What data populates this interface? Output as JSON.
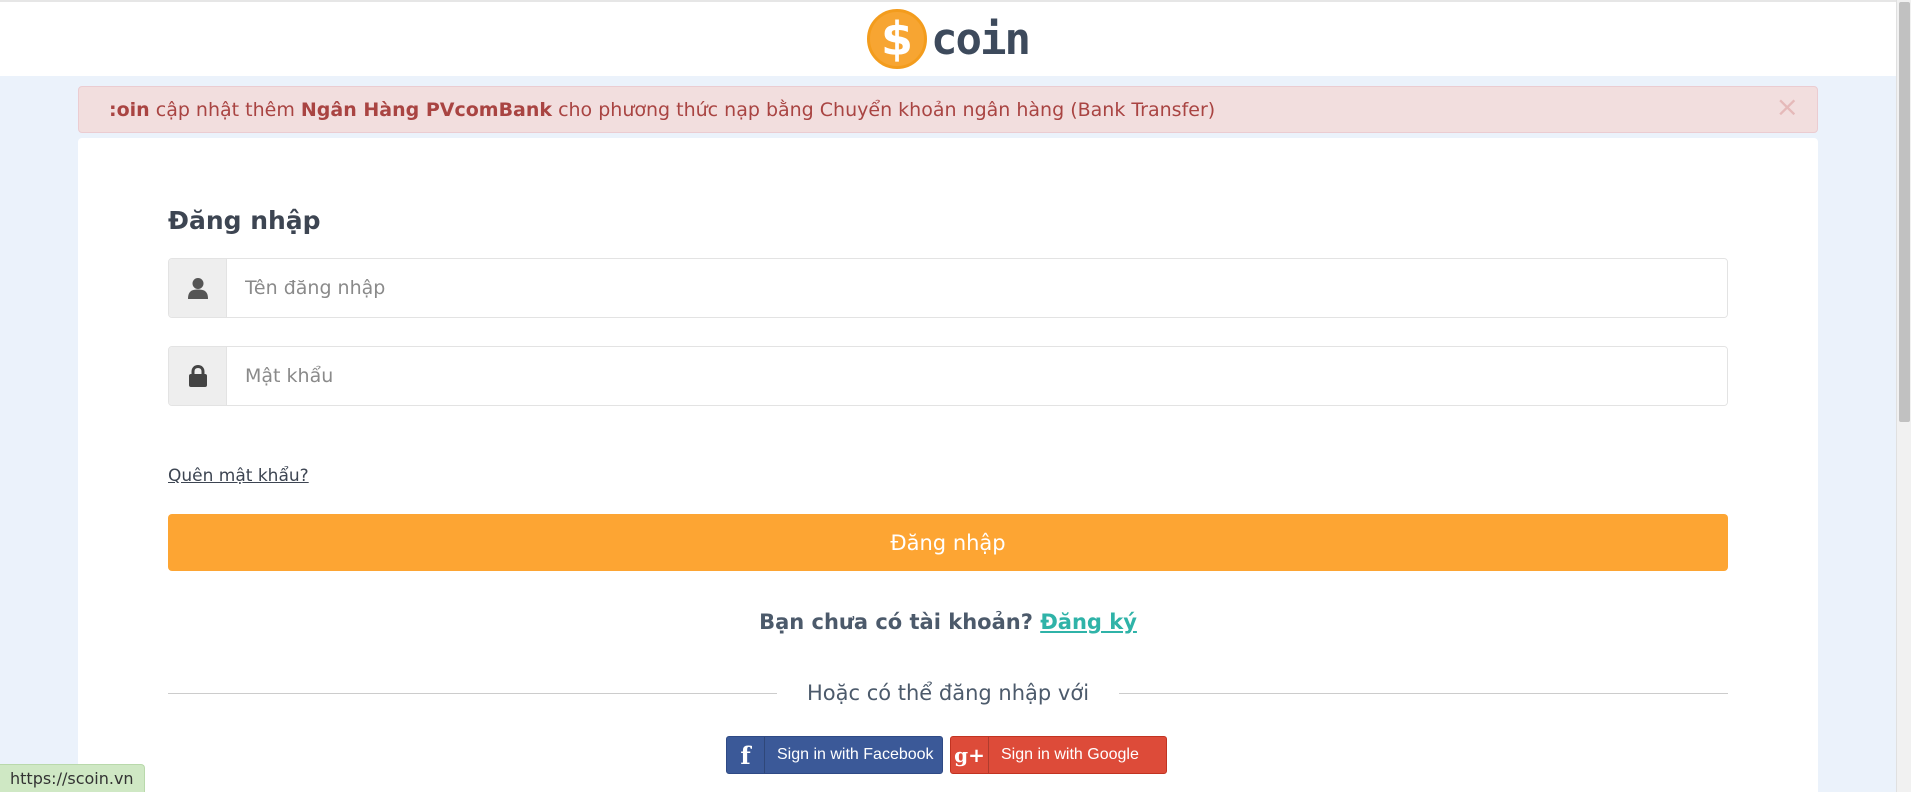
{
  "header": {
    "logo_symbol": "$",
    "logo_text": "coin"
  },
  "alert": {
    "prefix_bold": ":oin",
    "text_1": " cập nhật thêm ",
    "bank_bold": "Ngân Hàng PVcomBank",
    "text_2": " cho phương thức nạp bằng Chuyển khoản ngân hàng (Bank Transfer)",
    "close_symbol": "×"
  },
  "login_form": {
    "title": "Đăng nhập",
    "username_placeholder": "Tên đăng nhập",
    "password_placeholder": "Mật khẩu",
    "forgot_password": "Quên mật khẩu?",
    "submit_label": "Đăng nhập",
    "no_account_text": "Bạn chưa có tài khoản? ",
    "register_link": "Đăng ký",
    "divider_text": "Hoặc có thể đăng nhập với"
  },
  "social": {
    "facebook_icon": "f",
    "facebook_label": "Sign in with Facebook",
    "google_icon": "g+",
    "google_label": "Sign in with Google"
  },
  "status_bar": {
    "url": "https://scoin.vn"
  },
  "icons": {
    "user": "user-icon",
    "lock": "lock-icon",
    "facebook": "facebook-icon",
    "google": "google-plus-icon"
  },
  "colors": {
    "accent": "#fda533",
    "alert_bg": "#f2dede",
    "alert_text": "#a94442",
    "link": "#2fb3a8",
    "facebook": "#3b5998",
    "google": "#dd4b39"
  }
}
